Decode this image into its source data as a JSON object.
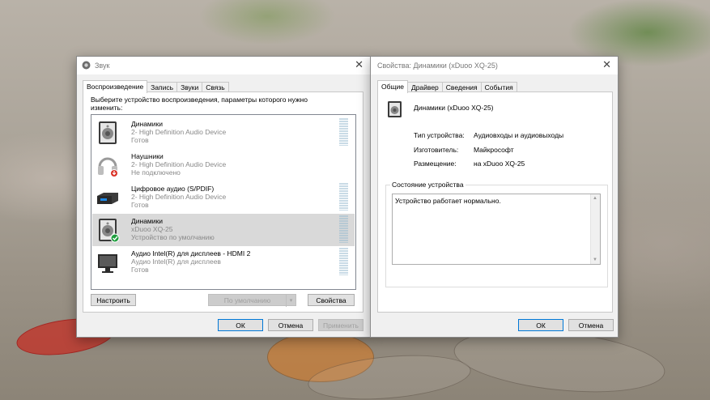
{
  "sound": {
    "title": "Звук",
    "tabs": [
      "Воспроизведение",
      "Запись",
      "Звуки",
      "Связь"
    ],
    "instruction": "Выберите устройство воспроизведения, параметры которого нужно изменить:",
    "devices": [
      {
        "name": "Динамики",
        "sub": "2- High Definition Audio Device",
        "status": "Готов",
        "icon": "speaker-icon"
      },
      {
        "name": "Наушники",
        "sub": "2- High Definition Audio Device",
        "status": "Не подключено",
        "icon": "headphones-icon"
      },
      {
        "name": "Цифровое аудио (S/PDIF)",
        "sub": "2- High Definition Audio Device",
        "status": "Готов",
        "icon": "digital-audio-icon"
      },
      {
        "name": "Динамики",
        "sub": "xDuoo XQ-25",
        "status": "Устройство по умолчанию",
        "icon": "speaker-icon"
      },
      {
        "name": "Аудио Intel(R) для дисплеев - HDMI 2",
        "sub": "Аудио Intel(R) для дисплеев",
        "status": "Готов",
        "icon": "monitor-icon"
      }
    ],
    "buttons": {
      "configure": "Настроить",
      "set_default": "По умолчанию",
      "properties": "Свойства",
      "ok": "ОК",
      "cancel": "Отмена",
      "apply": "Применить"
    }
  },
  "props": {
    "title": "Свойства: Динамики (xDuoo XQ-25)",
    "tabs": [
      "Общие",
      "Драйвер",
      "Сведения",
      "События"
    ],
    "device_name": "Динамики (xDuoo XQ-25)",
    "fields": [
      {
        "label": "Тип устройства:",
        "value": "Аудиовходы и аудиовыходы"
      },
      {
        "label": "Изготовитель:",
        "value": "Майкрософт"
      },
      {
        "label": "Размещение:",
        "value": "на xDuoo XQ-25"
      }
    ],
    "status_group": "Состояние устройства",
    "status_text": "Устройство работает нормально.",
    "buttons": {
      "ok": "ОК",
      "cancel": "Отмена"
    }
  }
}
